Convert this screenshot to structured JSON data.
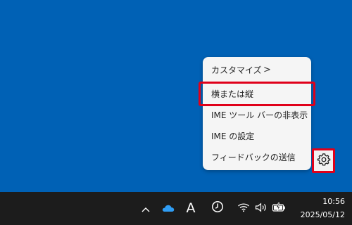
{
  "context_menu": {
    "items": [
      {
        "label": "カスタマイズ",
        "submenu_indicator": ">"
      },
      {
        "label": "横または縦"
      },
      {
        "label": "IME ツール バーの非表示"
      },
      {
        "label": "IME の設定"
      },
      {
        "label": "フィードバックの送信"
      }
    ],
    "highlighted_item": "横または縦"
  },
  "gear_button": {
    "icon": "gear-icon"
  },
  "taskbar": {
    "tray_icons": [
      "chevron-up-icon",
      "onedrive-cloud-icon",
      "ime-mode-icon",
      "clock-timer-icon",
      "wifi-icon",
      "volume-icon",
      "battery-icon"
    ],
    "ime_mode_label": "A",
    "clock": {
      "time": "10:56",
      "date": "2025/05/12"
    }
  },
  "colors": {
    "desktop": "#0061b5",
    "taskbar": "#1c1c1c",
    "menu_bg": "#f5f5f5",
    "highlight": "#e0001a",
    "onedrive": "#2f9df4"
  }
}
